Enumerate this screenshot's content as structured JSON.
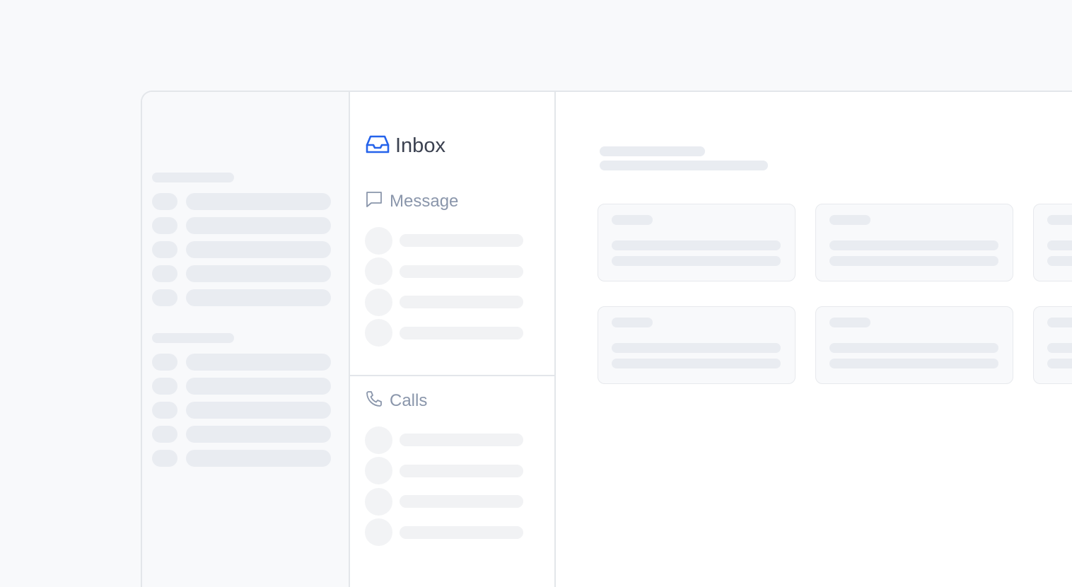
{
  "inbox": {
    "title": "Inbox",
    "icon": "inbox-icon",
    "accent_color": "#2563eb",
    "sections": [
      {
        "label": "Message",
        "icon": "message-icon"
      },
      {
        "label": "Calls",
        "icon": "phone-icon"
      }
    ]
  }
}
